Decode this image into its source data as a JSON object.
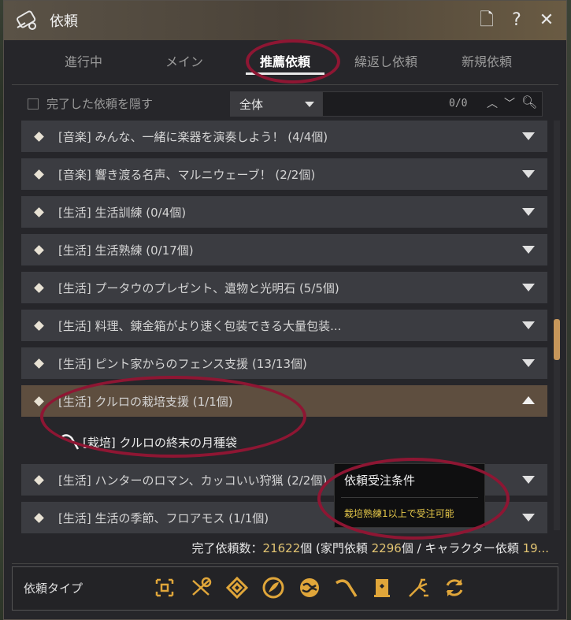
{
  "window": {
    "title": "依頼"
  },
  "title_buttons": {
    "page": "🗋",
    "help": "?",
    "close": "✕"
  },
  "tabs": [
    {
      "label": "進行中"
    },
    {
      "label": "メイン"
    },
    {
      "label": "推薦依頼",
      "active": true
    },
    {
      "label": "繰返し依頼"
    },
    {
      "label": "新規依頼"
    }
  ],
  "filter": {
    "hide_completed_label": "完了した依頼を隠す",
    "dropdown_value": "全体",
    "search_count": "0/0"
  },
  "quests": [
    {
      "text": "[音楽] みんな、一緒に楽器を演奏しよう！ (4/4個)"
    },
    {
      "text": "[音楽] 響き渡る名声、マルニウェーブ！ (2/2個)"
    },
    {
      "text": "[生活] 生活訓練 (0/4個)"
    },
    {
      "text": "[生活] 生活熟練 (0/17個)"
    },
    {
      "text": "[生活] プータウのプレゼント、遺物と光明石 (5/5個)"
    },
    {
      "text": "[生活] 料理、錬金箱がより速く包装できる大量包装..."
    },
    {
      "text": "[生活] ピント家からのフェンス支援 (13/13個)"
    },
    {
      "text": "[生活] クルロの栽培支援 (1/1個)",
      "expanded": true
    },
    {
      "text": "[生活] ハンターのロマン、カッコいい狩猟 (2/2個)"
    },
    {
      "text": "[生活] 生活の季節、フロアモス (1/1個)"
    }
  ],
  "subquest": {
    "text": "[栽培] クルロの終末の月種袋"
  },
  "tooltip": {
    "title": "依頼受注条件",
    "condition": "栽培熟練1以上で受注可能"
  },
  "summary": {
    "prefix": "完了依頼数：",
    "total": "21622",
    "mid1": "個 (家門依頼 ",
    "family": "2296",
    "mid2": "個 / キャラクター依頼 ",
    "character": "19..."
  },
  "footer": {
    "label": "依頼タイプ",
    "type_icons": [
      "all-icon",
      "scroll-icon",
      "trade-icon",
      "feather-icon",
      "globe-icon",
      "pickaxe-icon",
      "book-icon",
      "broom-icon",
      "refresh-icon"
    ]
  },
  "colors": {
    "accent": "#e2c472",
    "icon_gold": "#e0a63a",
    "highlight_circle": "#8e1633",
    "expanded_row": "#5e4e3f"
  }
}
